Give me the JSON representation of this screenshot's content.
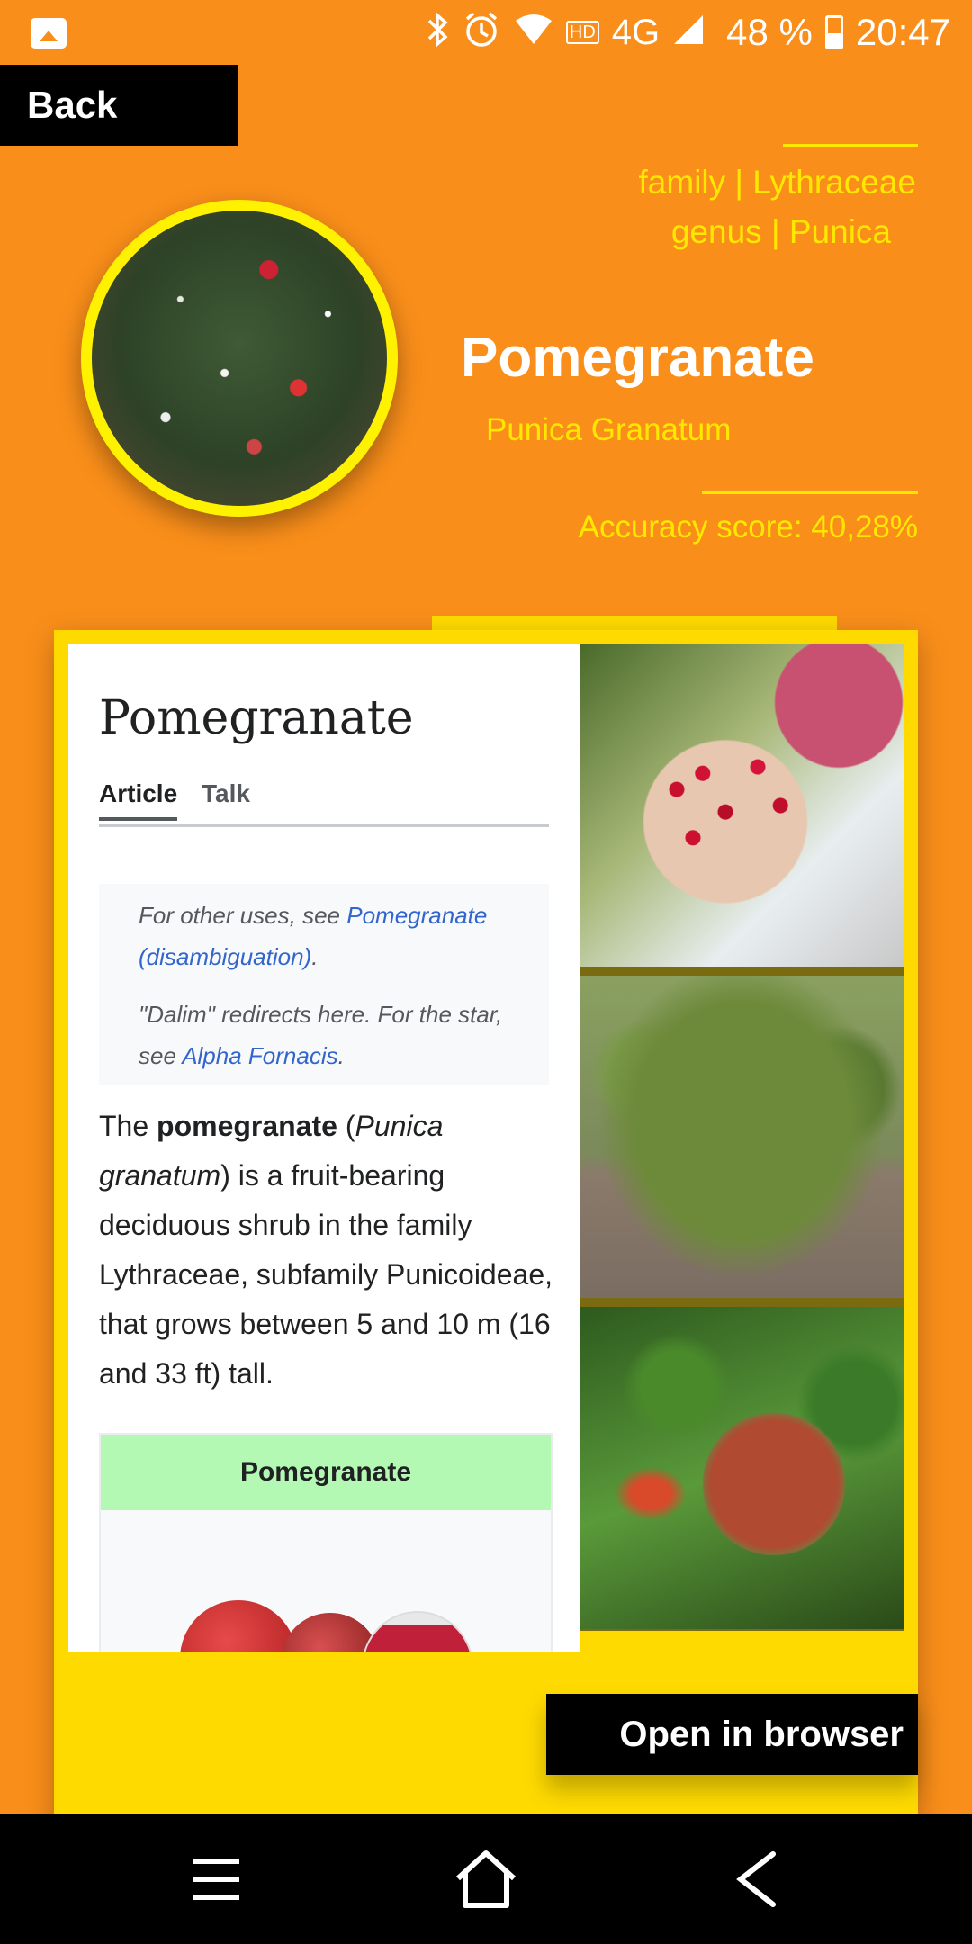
{
  "status_bar": {
    "battery": "48 %",
    "time": "20:47",
    "network": "4G",
    "hd": "HD"
  },
  "back_label": "Back",
  "taxonomy": {
    "family": "family | Lythraceae",
    "genus": "genus | Punica"
  },
  "species": {
    "name": "Pomegranate",
    "latin": "Punica Granatum",
    "accuracy": "Accuracy score: 40,28%"
  },
  "wiki": {
    "title": "Pomegranate",
    "tabs": [
      "Article",
      "Talk"
    ],
    "hatnote1_prefix": "For other uses, see ",
    "hatnote1_link": "Pomegranate (disambiguation)",
    "hatnote1_suffix": ".",
    "hatnote2_prefix": "\"Dalim\" redirects here. For the star, see ",
    "hatnote2_link": "Alpha Fornacis",
    "hatnote2_suffix": ".",
    "body_start": "The ",
    "body_bold": "pomegranate",
    "body_paren_open": " (",
    "body_italic": "Punica granatum",
    "body_rest": ") is a fruit-bearing deciduous shrub in the family Lythraceae, subfamily Punicoideae, that grows between 5 and 10 m (16 and 33 ft) tall.",
    "infobox_title": "Pomegranate"
  },
  "open_browser_label": "Open in browser",
  "colors": {
    "background": "#F98E1A",
    "accent_yellow": "#FFE800",
    "panel_yellow": "#FFDA00"
  }
}
